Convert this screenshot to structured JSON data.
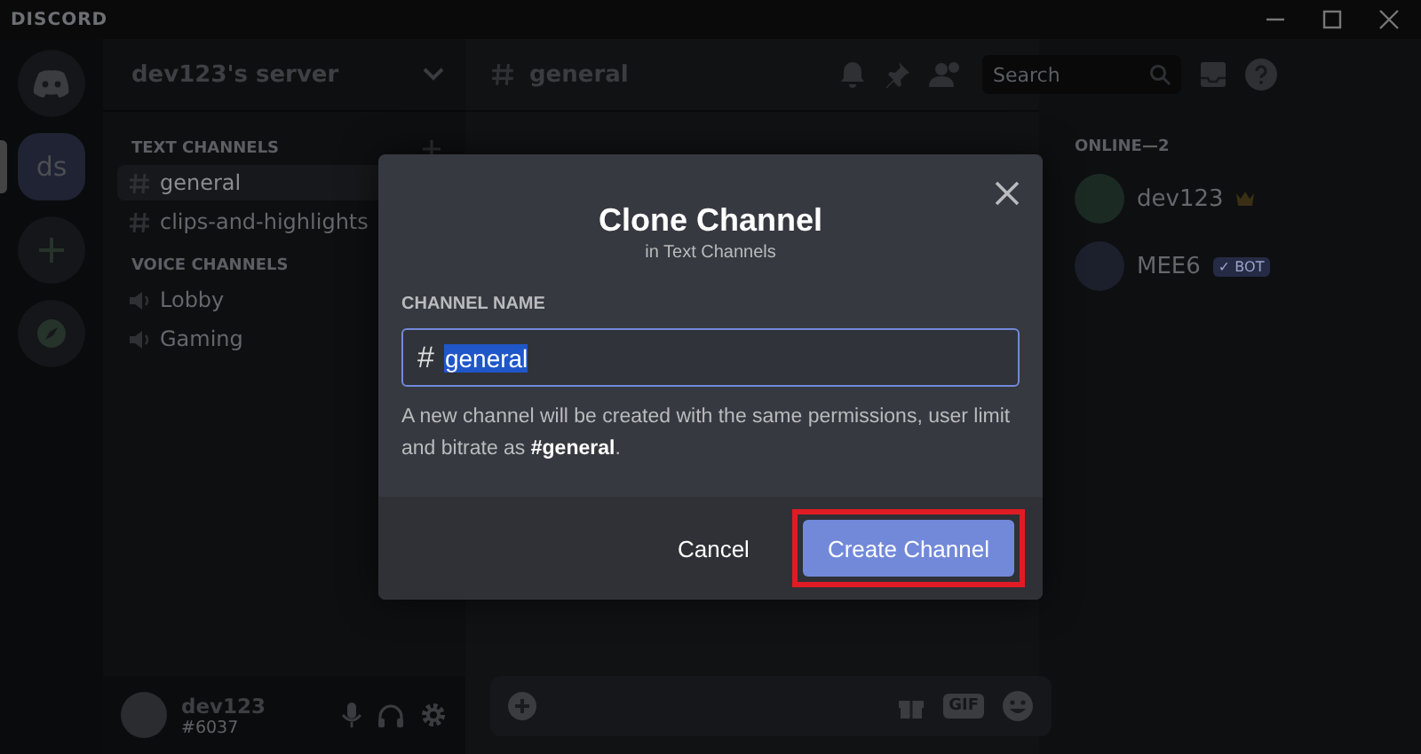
{
  "window": {
    "title": "DISCORD"
  },
  "server": {
    "name": "dev123's server",
    "avatar": "ds",
    "selected": true
  },
  "channel_header": {
    "name": "general",
    "search_placeholder": "Search"
  },
  "sidebar": {
    "groups": [
      {
        "title": "TEXT CHANNELS",
        "kind": "text",
        "items": [
          {
            "name": "general",
            "selected": true
          },
          {
            "name": "clips-and-highlights",
            "selected": false
          }
        ]
      },
      {
        "title": "VOICE CHANNELS",
        "kind": "voice",
        "items": [
          {
            "name": "Lobby",
            "selected": false
          },
          {
            "name": "Gaming",
            "selected": false
          }
        ]
      }
    ]
  },
  "user": {
    "name": "dev123",
    "tag": "#6037"
  },
  "composer": {
    "gif": "GIF"
  },
  "members": {
    "title": "ONLINE—2",
    "items": [
      {
        "name": "dev123",
        "owner": true
      },
      {
        "name": "MEE6",
        "badge": "✓ BOT",
        "owner": false
      }
    ]
  },
  "modal": {
    "title": "Clone Channel",
    "subtitle": "in Text Channels",
    "label": "CHANNEL NAME",
    "prefix": "#",
    "value": "general",
    "value_selected": true,
    "description": "A new channel will be created with the same permissions, user limit and bitrate as **#general**.",
    "buttons": [
      {
        "label": "Cancel",
        "kind": "link",
        "highlighted": false
      },
      {
        "label": "Create Channel",
        "kind": "primary",
        "highlighted": true
      }
    ]
  }
}
